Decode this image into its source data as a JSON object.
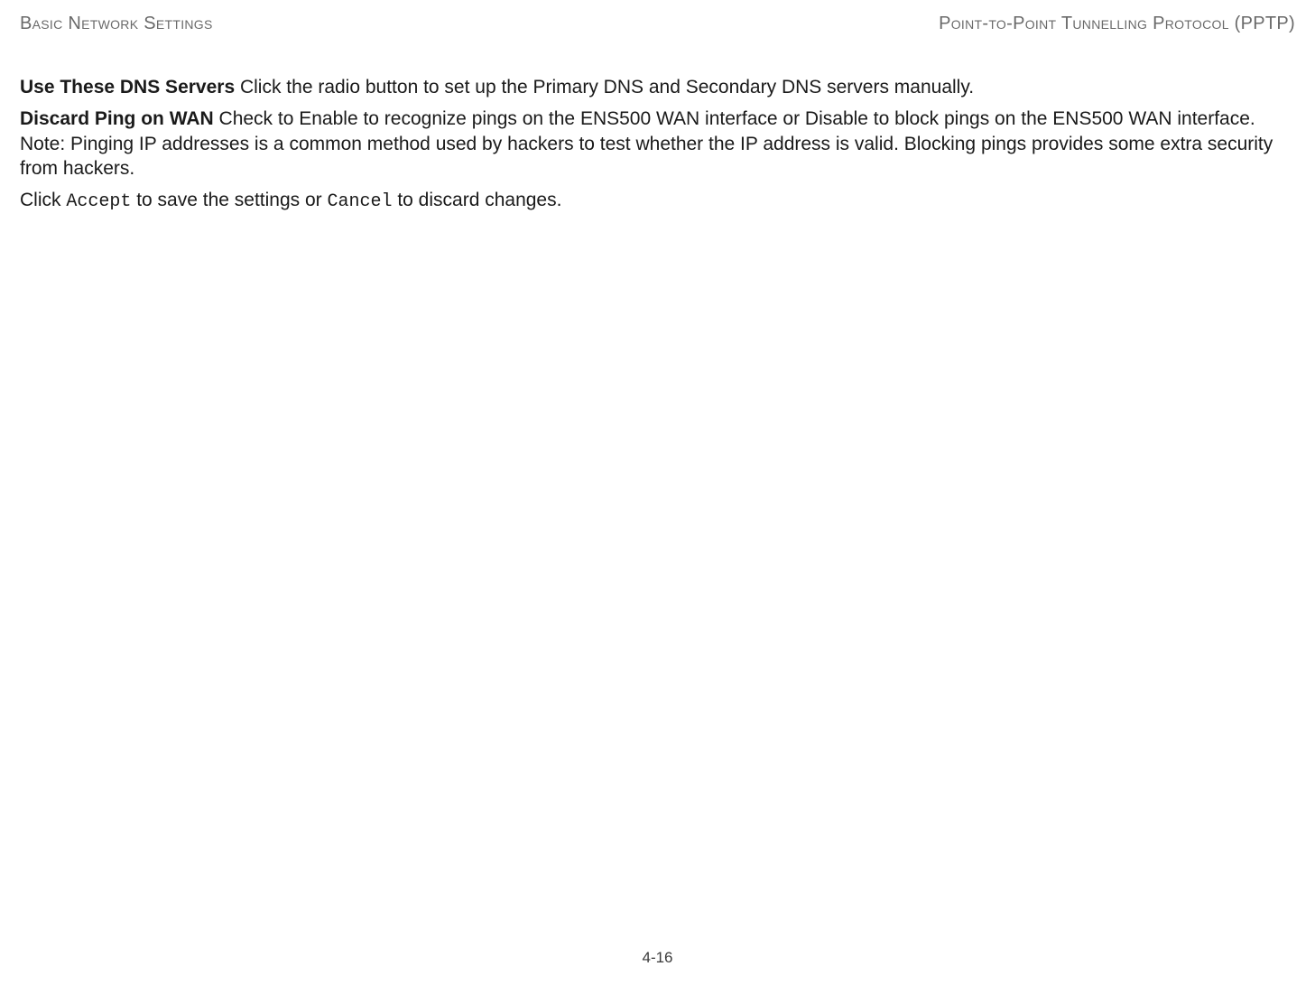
{
  "header": {
    "left": "Basic Network Settings",
    "right": "Point-to-Point Tunnelling Protocol (PPTP)"
  },
  "body": {
    "dns_title": "Use These DNS Servers",
    "dns_body": "  Click the radio button to set up the Primary DNS and Secondary DNS servers manually.",
    "ping_title": "Discard Ping on WAN",
    "ping_body": "  Check to Enable to recognize pings on the ENS500 WAN interface or Disable to block pings on the ENS500 WAN interface. Note: Pinging IP addresses is a common method used by hackers to test whether the IP address is valid. Blocking pings provides some extra security from hackers.",
    "click_prefix": "Click ",
    "accept": "Accept",
    "click_mid": " to save the settings or ",
    "cancel": "Cancel",
    "click_suffix": " to discard changes."
  },
  "footer": {
    "page": "4-16"
  }
}
